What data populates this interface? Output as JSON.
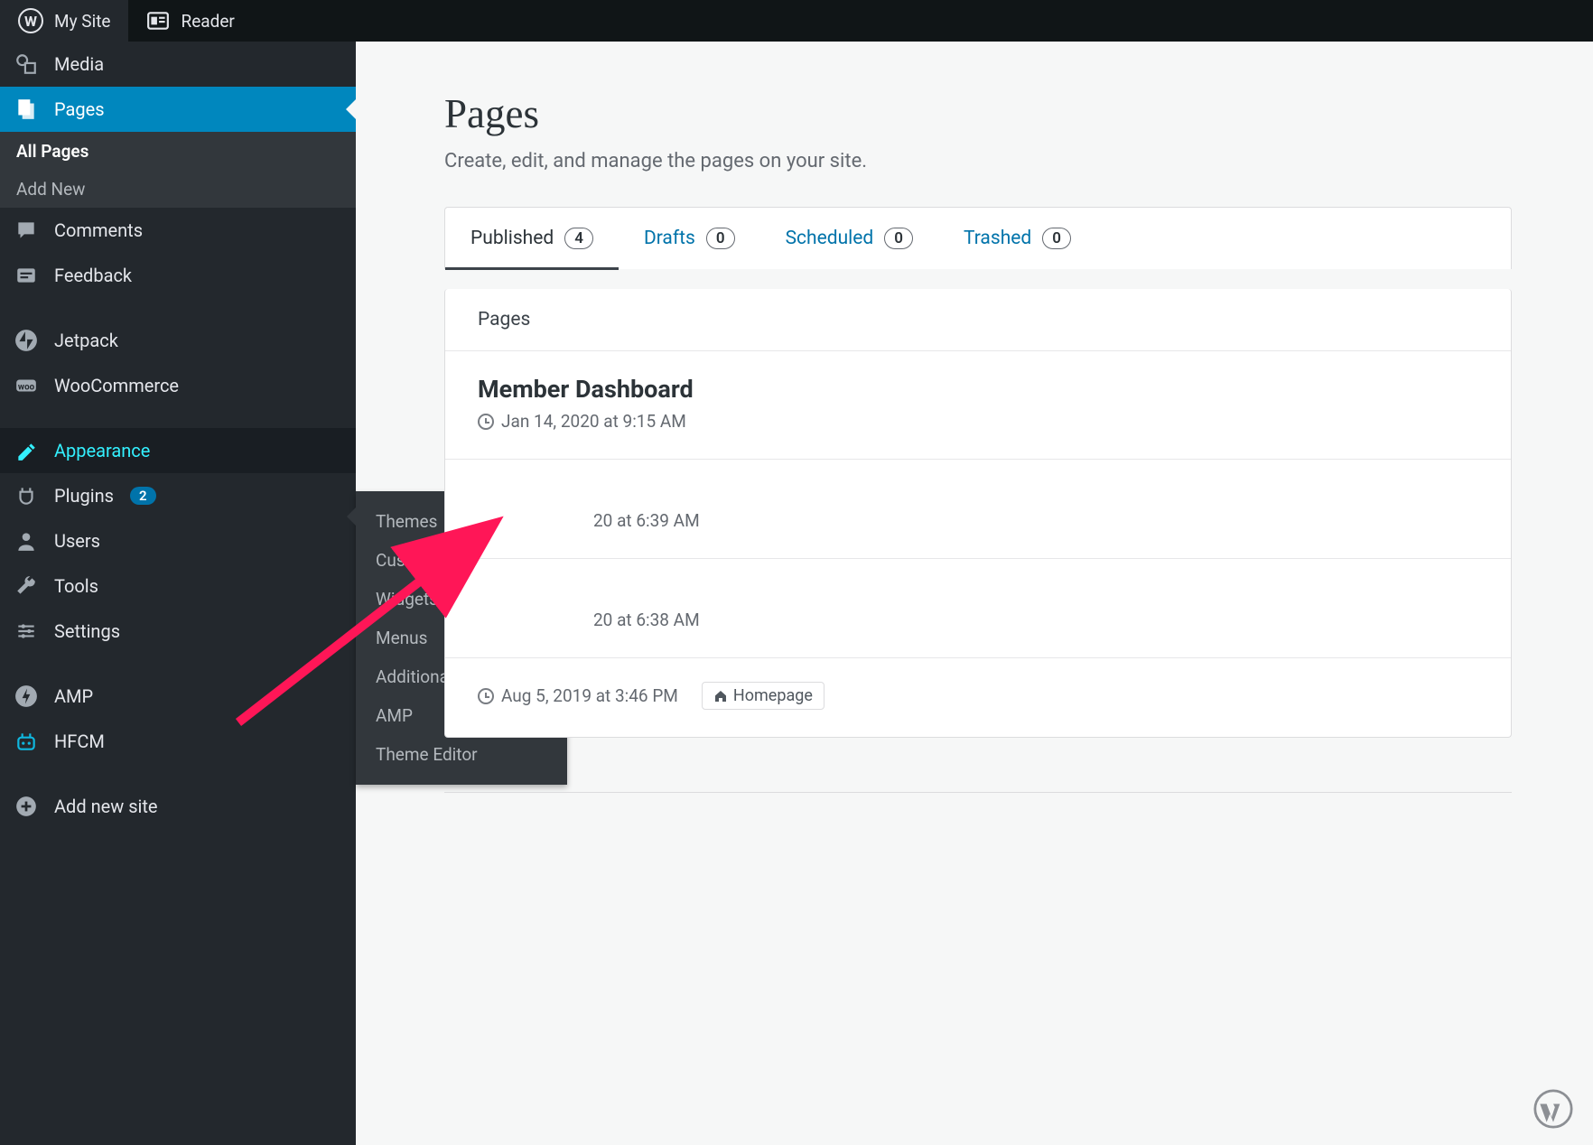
{
  "topbar": {
    "my_site": "My Site",
    "reader": "Reader"
  },
  "sidebar": {
    "items": {
      "media": "Media",
      "pages": "Pages",
      "comments": "Comments",
      "feedback": "Feedback",
      "jetpack": "Jetpack",
      "woocommerce": "WooCommerce",
      "appearance": "Appearance",
      "plugins": "Plugins",
      "plugins_count": "2",
      "users": "Users",
      "tools": "Tools",
      "settings": "Settings",
      "amp": "AMP",
      "hfcm": "HFCM",
      "add_new_site": "Add new site"
    },
    "pages_sub": {
      "all_pages": "All Pages",
      "add_new": "Add New"
    }
  },
  "flyout": {
    "themes": "Themes",
    "customize": "Customize",
    "widgets": "Widgets",
    "menus": "Menus",
    "additional_css": "Additional CSS",
    "amp": "AMP",
    "theme_editor": "Theme Editor"
  },
  "main": {
    "title": "Pages",
    "subtitle": "Create, edit, and manage the pages on your site.",
    "tabs": {
      "published": "Published",
      "published_count": "4",
      "drafts": "Drafts",
      "drafts_count": "0",
      "scheduled": "Scheduled",
      "scheduled_count": "0",
      "trashed": "Trashed",
      "trashed_count": "0"
    },
    "list_header": "Pages",
    "row1": {
      "title": "Member Dashboard",
      "date": "Jan 14, 2020 at 9:15 AM"
    },
    "row2": {
      "date_fragment": "20 at 6:39 AM"
    },
    "row3": {
      "date_fragment": "20 at 6:38 AM"
    },
    "row4": {
      "date": "Aug 5, 2019 at 3:46 PM",
      "homepage_label": "Homepage"
    }
  }
}
